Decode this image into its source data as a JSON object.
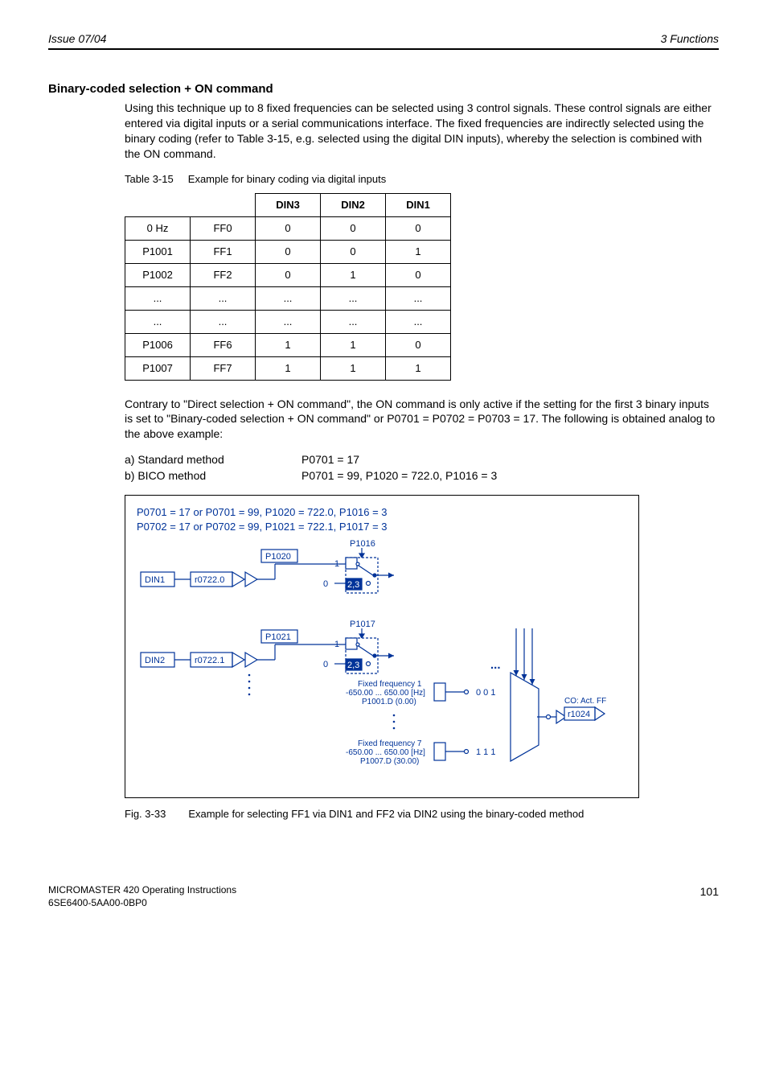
{
  "header": {
    "left": "Issue 07/04",
    "right": "3  Functions"
  },
  "section_title": "Binary-coded selection + ON command",
  "intro": "Using this technique up to 8 fixed frequencies can be selected using 3 control signals. These control signals are either entered via digital inputs or a serial communications interface. The fixed frequencies are indirectly selected using the binary coding (refer to Table 3-15,      e.g. selected using the digital DIN inputs), whereby the selection is combined with the ON command.",
  "table_caption": {
    "num": "Table 3-15",
    "text": "Example for binary coding via digital inputs"
  },
  "table": {
    "headers": [
      "DIN3",
      "DIN2",
      "DIN1"
    ],
    "rows": [
      {
        "c0": "0 Hz",
        "c1": "FF0",
        "v": [
          "0",
          "0",
          "0"
        ]
      },
      {
        "c0": "P1001",
        "c1": "FF1",
        "v": [
          "0",
          "0",
          "1"
        ]
      },
      {
        "c0": "P1002",
        "c1": "FF2",
        "v": [
          "0",
          "1",
          "0"
        ]
      },
      {
        "c0": "...",
        "c1": "...",
        "v": [
          "...",
          "...",
          "..."
        ]
      },
      {
        "c0": "...",
        "c1": "...",
        "v": [
          "...",
          "...",
          "..."
        ]
      },
      {
        "c0": "P1006",
        "c1": "FF6",
        "v": [
          "1",
          "1",
          "0"
        ]
      },
      {
        "c0": "P1007",
        "c1": "FF7",
        "v": [
          "1",
          "1",
          "1"
        ]
      }
    ]
  },
  "para2": "Contrary to \"Direct selection + ON command\", the ON command is only active if the setting for the first 3 binary inputs is set to \"Binary-coded selection + ON command\" or P0701 = P0702 = P0703 = 17. The following is obtained analog to the above example:",
  "methods": {
    "a_label": "a)  Standard method",
    "a_val": "P0701 = 17",
    "b_label": "b)  BICO method",
    "b_val": "P0701 = 99, P1020 = 722.0, P1016 = 3"
  },
  "diagram": {
    "cfg1": "P0701 = 17 or P0701 = 99, P1020 = 722.0, P1016 = 3",
    "cfg2": "P0702 = 17 or P0702 = 99, P1021 = 722.1, P1017 = 3",
    "din1": "DIN1",
    "din2": "DIN2",
    "r0722_0": "r0722.0",
    "r0722_1": "r0722.1",
    "p1020": "P1020",
    "p1021": "P1021",
    "p1016": "P1016",
    "p1017": "P1017",
    "zero": "0",
    "one": "1",
    "twothree": "2,3",
    "dots": "...",
    "ff1_l1": "Fixed frequency 1",
    "ff1_l2": "-650.00 ... 650.00  [Hz]",
    "ff1_l3": "P1001.D (0.00)",
    "ff7_l1": "Fixed frequency 7",
    "ff7_l2": "-650.00 ... 650.00  [Hz]",
    "ff7_l3": "P1007.D (30.00)",
    "sel_001": "0  0  1",
    "sel_111": "1  1  1",
    "co_act_ff": "CO: Act. FF",
    "r1024": "r1024"
  },
  "fig_caption": {
    "num": "Fig. 3-33",
    "text": "Example for selecting FF1 via DIN1 and FF2 via DIN2 using the binary-coded method"
  },
  "footer": {
    "line1": "MICROMASTER 420    Operating Instructions",
    "line2": "6SE6400-5AA00-0BP0",
    "page": "101"
  }
}
